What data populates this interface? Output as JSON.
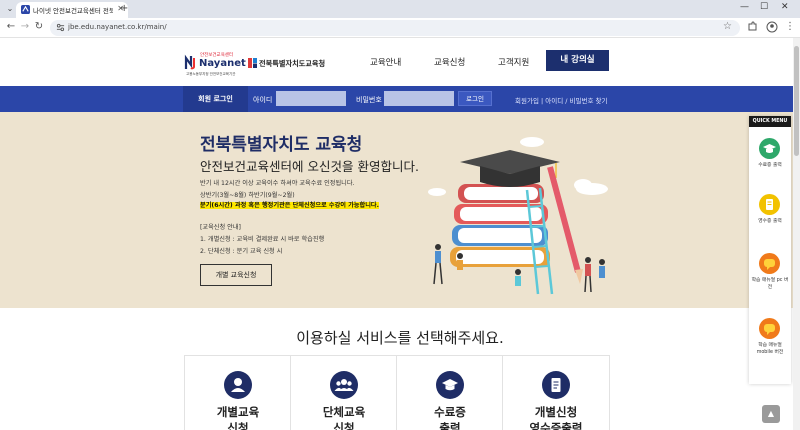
{
  "browser": {
    "tab_title": "나이넷 안전보건교육센터 전북",
    "url": "jbe.edu.nayanet.co.kr/main/",
    "minimize": "—",
    "maximize": "☐",
    "close": "✕"
  },
  "logos": {
    "nayanet_small": "안전보건교육센터",
    "nayanet_name": "Nayanet",
    "nayanet_sub": "고용노동부지정 안전보건교육기관",
    "jeonbuk": "전북특별자치도교육청"
  },
  "gnb": {
    "items": [
      "교육안내",
      "교육신청",
      "고객지원"
    ],
    "my_lecture": "내 강의실"
  },
  "login": {
    "label": "회원 로그인",
    "id_label": "아이디",
    "pw_label": "비밀번호",
    "button": "로그인",
    "links": "회원가입  |  아이디 / 비밀번호 찾기"
  },
  "hero": {
    "title": "전북특별자치도 교육청",
    "subtitle": "안전보건교육센터에 오신것을 환영합니다.",
    "line1": "반기 내 12시간 이상 교육이수 하셔야 교육수료 인정됩니다.",
    "line2": "상반기(3월~8월) 하반기(9월~2월)",
    "line3": "분기(6시간) 과정 혹은 행정기관은 단체신청으로 수강이 가능합니다.",
    "line4": "[교육신청 안내]",
    "line5": "1. 개별신청 : 교육비 결제완료 시 바로 학습진행",
    "line6": "2. 단체신청 : 분기 교육 신청 시",
    "button": "개별 교육신청"
  },
  "quick_menu": {
    "title": "QUICK MENU",
    "items": [
      {
        "label": "수료증 출력",
        "icon": "graduation-cap-icon",
        "color": "#2ea86a"
      },
      {
        "label": "영수증 출력",
        "icon": "receipt-icon",
        "color": "#f2c200"
      },
      {
        "label": "학습 매뉴얼 pc 버전",
        "icon": "chat-icon",
        "color": "#f07a1a"
      },
      {
        "label": "학습 매뉴얼 mobile 버전",
        "icon": "chat-icon",
        "color": "#f07a1a"
      }
    ]
  },
  "section": {
    "title": "이용하실 서비스를 선택해주세요.",
    "cards": [
      {
        "label": "개별교육\n신청",
        "icon": "user-icon"
      },
      {
        "label": "단체교육\n신청",
        "icon": "users-icon"
      },
      {
        "label": "수료증\n출력",
        "icon": "graduation-cap-icon"
      },
      {
        "label": "개별신청\n영수증출력",
        "icon": "receipt-icon"
      }
    ]
  },
  "colors": {
    "primary": "#1f2d66",
    "loginbar": "#2b46a8",
    "hero_bg": "#ede3cf"
  }
}
